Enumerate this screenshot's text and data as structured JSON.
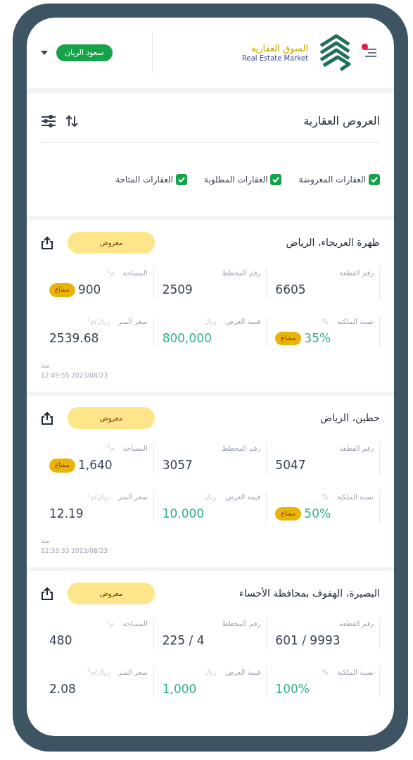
{
  "header": {
    "user_chip": "سعود الريان",
    "logo_title": "السوق العقارية",
    "logo_subtitle": "Real Estate Market",
    "menu_has_notification": true
  },
  "section": {
    "title": "العروض العقارية"
  },
  "filters": [
    {
      "label": "العقارات المعروضة",
      "checked": true
    },
    {
      "label": "العقارات المطلوبة",
      "checked": true
    },
    {
      "label": "العقارات المتاحة",
      "checked": true
    }
  ],
  "listings": [
    {
      "title": "ظهرة العريجاء، الرياض",
      "status": "معروض",
      "since_label": "منذ",
      "date": "2023/08/23 12:49:55",
      "fields": [
        {
          "label": "رقم القطعة",
          "value": "6605",
          "highlight": false
        },
        {
          "label": "رقم المخطط",
          "value": "2509",
          "highlight": false
        },
        {
          "label": "المساحة",
          "unit": "م²",
          "value": "900",
          "badge": "مشاع",
          "highlight": false
        },
        {
          "label": "نسبة الملكية",
          "unit": "%",
          "value": "35%",
          "badge": "مشاع",
          "highlight": true
        },
        {
          "label": "قيمة العرض",
          "unit": "ريال",
          "value": "800,000",
          "highlight": true
        },
        {
          "label": "سعر المتر",
          "unit": "ريال/م²",
          "value": "2539.68",
          "highlight": false
        }
      ]
    },
    {
      "title": "حطين، الرياض",
      "status": "معروض",
      "since_label": "منذ",
      "date": "2023/08/23 12:33:33",
      "fields": [
        {
          "label": "رقم القطعة",
          "value": "5047",
          "highlight": false
        },
        {
          "label": "رقم المخطط",
          "value": "3057",
          "highlight": false
        },
        {
          "label": "المساحة",
          "unit": "م²",
          "value": "1,640",
          "badge": "مشاع",
          "highlight": false
        },
        {
          "label": "نسبة الملكية",
          "unit": "%",
          "value": "50%",
          "badge": "مشاع",
          "highlight": true
        },
        {
          "label": "قيمة العرض",
          "unit": "ريال",
          "value": "10.000",
          "highlight": true
        },
        {
          "label": "سعر المتر",
          "unit": "ريال/م²",
          "value": "12.19",
          "highlight": false
        }
      ]
    },
    {
      "title": "البصيرة، الهفوف بمحافظة الأحساء",
      "status": "معروض",
      "fields": [
        {
          "label": "رقم القطعة",
          "value": "601 / 9993",
          "highlight": false
        },
        {
          "label": "رقم المخطط",
          "value": "225 / 4",
          "highlight": false
        },
        {
          "label": "المساحة",
          "unit": "م²",
          "value": "480",
          "highlight": false
        },
        {
          "label": "نسبة الملكية",
          "unit": "%",
          "value": "100%",
          "highlight": true
        },
        {
          "label": "قيمة العرض",
          "unit": "ريال",
          "value": "1,000",
          "highlight": true
        },
        {
          "label": "سعر المتر",
          "unit": "ريال/م²",
          "value": "2.08",
          "highlight": false
        }
      ]
    }
  ]
}
